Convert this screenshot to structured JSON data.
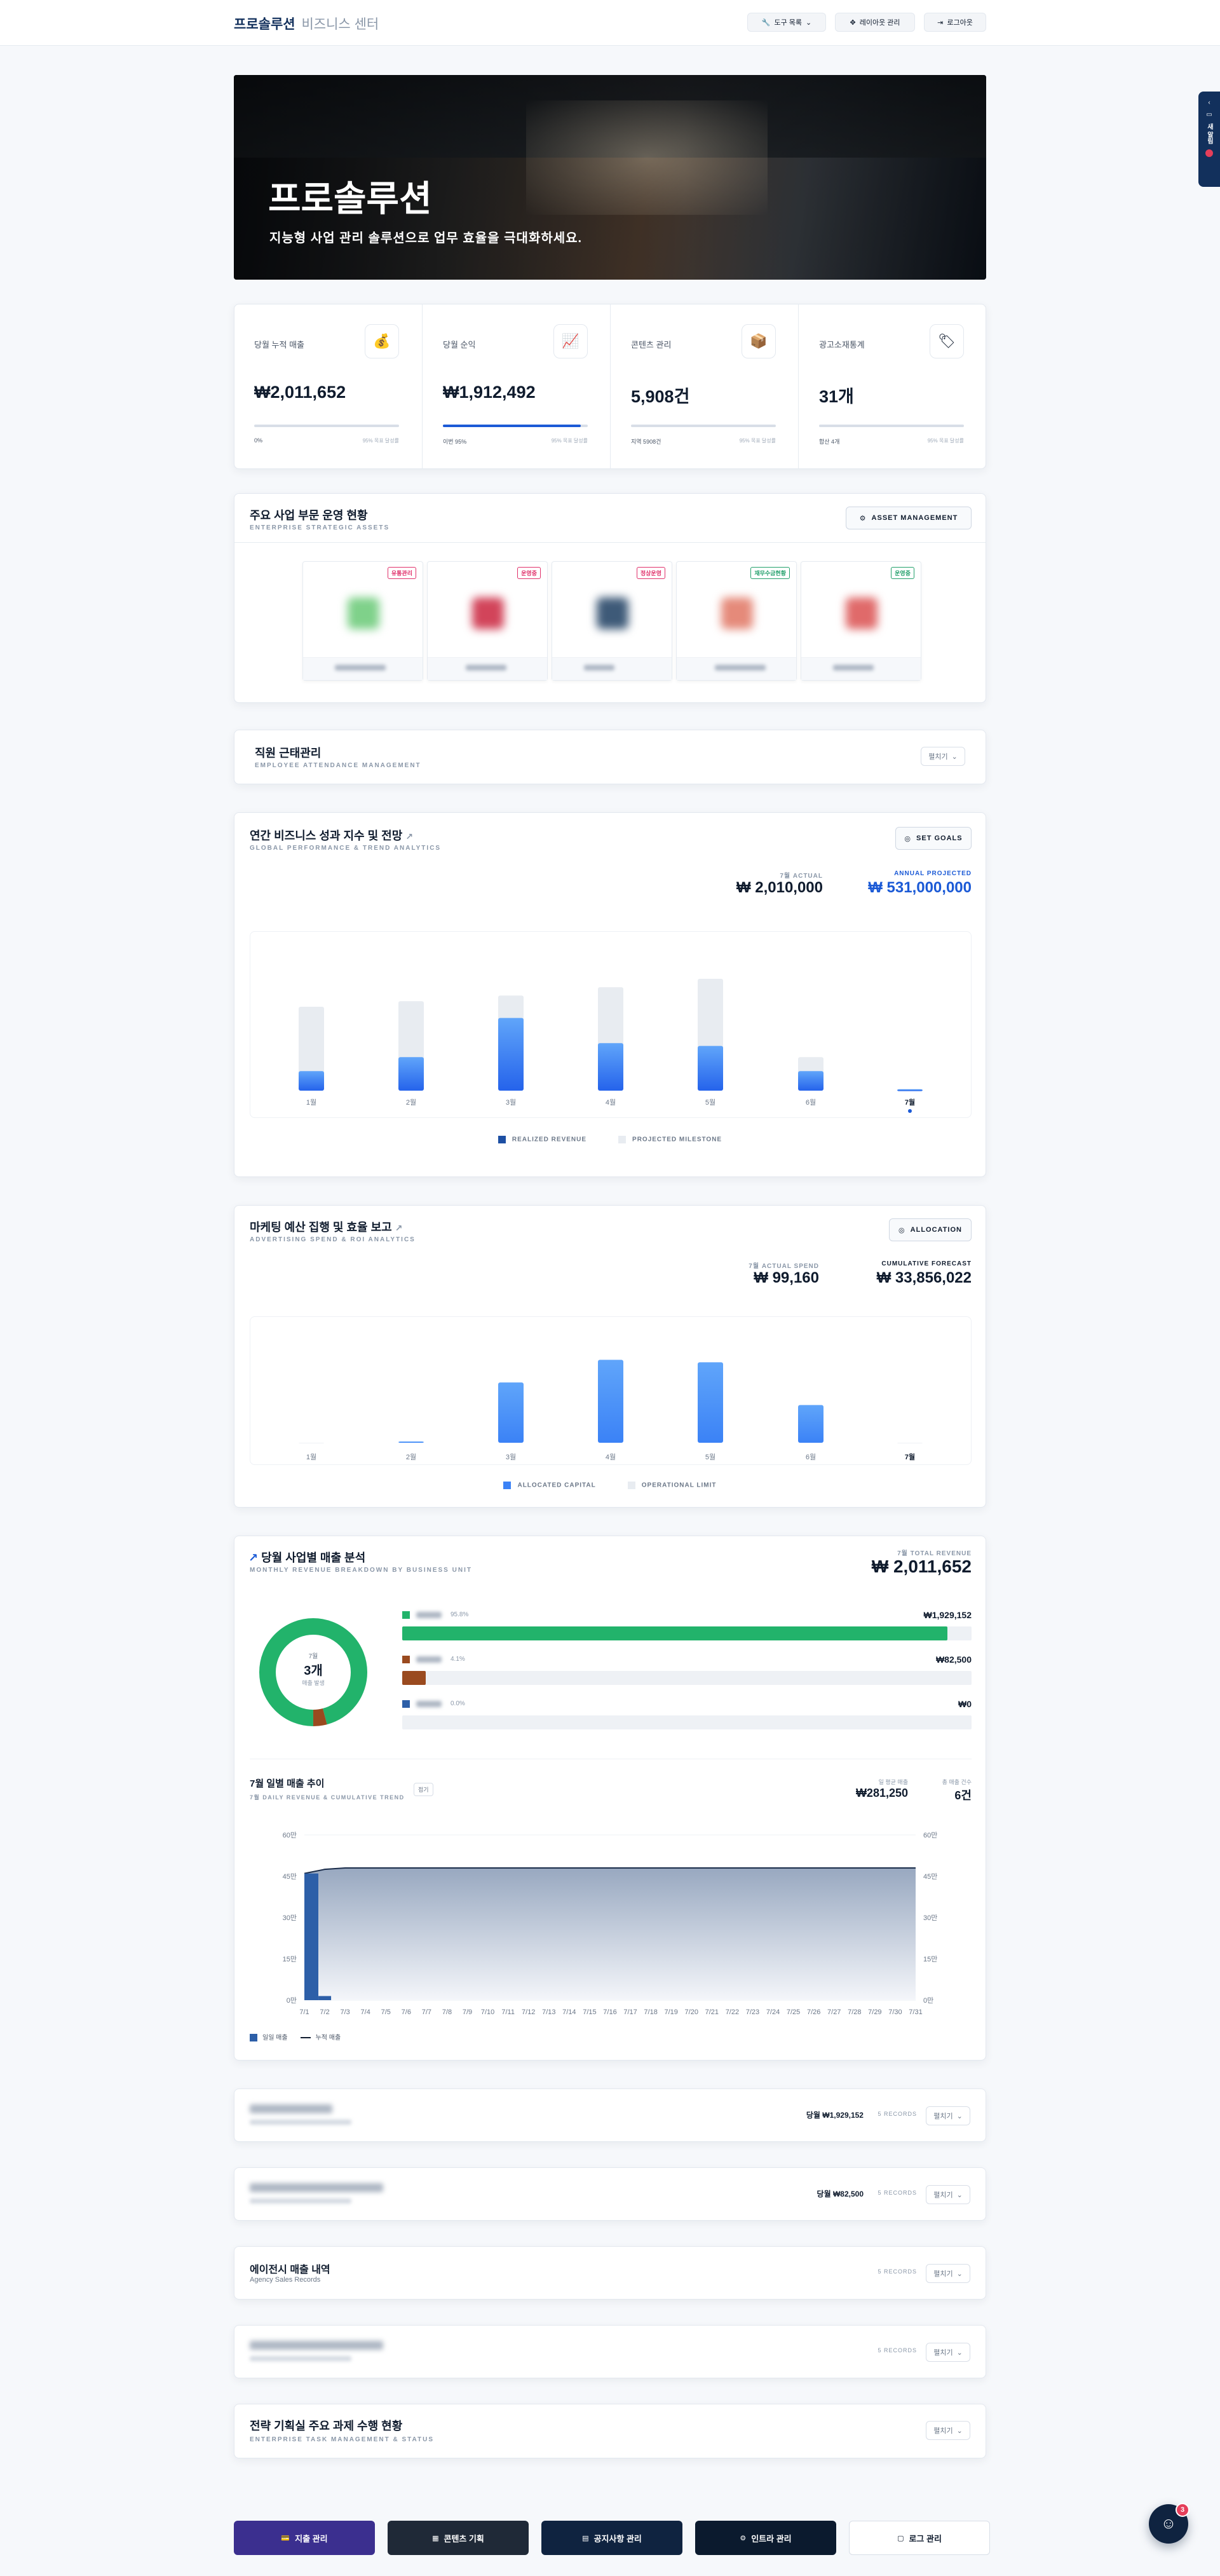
{
  "header": {
    "brand": "프로솔루션",
    "brand_sub": "비즈니스 센터",
    "tools_btn": "도구 목록",
    "layout_btn": "레이아웃 관리",
    "logout_btn": "로그아웃"
  },
  "side_tab": {
    "label": "새 알림"
  },
  "hero": {
    "title": "프로솔루션",
    "subtitle": "지능형 사업 관리 솔루션으로 업무 효율을 극대화하세요."
  },
  "stats": [
    {
      "label": "당월 누적 매출",
      "value": "₩2,011,652",
      "foot_left": "0%",
      "foot_right": "95% 목표 달성률",
      "progress": 0.0
    },
    {
      "label": "당월 순익",
      "value": "₩1,912,492",
      "foot_left": "이번 95%",
      "foot_right": "95% 목표 달성률",
      "progress": 0.95
    },
    {
      "label": "콘텐츠 관리",
      "value": "5,908건",
      "foot_left": "지역 5908건",
      "foot_right": "95% 목표 달성률",
      "progress": 0.0
    },
    {
      "label": "광고소재통계",
      "value": "31개",
      "foot_left": "합산 4개",
      "foot_right": "95% 목표 달성률",
      "progress": 0.0
    }
  ],
  "business": {
    "title": "주요 사업 부문 운영 현황",
    "subtitle": "ENTERPRISE STRATEGIC ASSETS",
    "button": "ASSET MANAGEMENT",
    "units": [
      {
        "badge": "유통관리",
        "badge_color": "#e0306a",
        "thumb": "#7fd18a"
      },
      {
        "badge": "운영중",
        "badge_color": "#e0306a",
        "thumb": "#d2445a"
      },
      {
        "badge": "정상운영",
        "badge_color": "#e0306a",
        "thumb": "#3e5a78"
      },
      {
        "badge": "재무수금현황",
        "badge_color": "#22a06b",
        "thumb": "#e58a7a"
      },
      {
        "badge": "운영중",
        "badge_color": "#22a06b",
        "thumb": "#e06a6a"
      }
    ]
  },
  "attendance": {
    "title": "직원 근태관리",
    "subtitle": "EMPLOYEE ATTENDANCE MANAGEMENT",
    "toggle": "펼치기"
  },
  "annual": {
    "title": "연간 비즈니스 성과 지수 및 전망",
    "subtitle": "GLOBAL PERFORMANCE & TREND ANALYTICS",
    "button": "SET GOALS",
    "actual_label": "7월 ACTUAL",
    "actual_value": "₩ 2,010,000",
    "projected_label": "ANNUAL PROJECTED",
    "projected_value": "₩ 531,000,000",
    "legend_realized": "REALIZED REVENUE",
    "legend_projected": "PROJECTED MILESTONE"
  },
  "marketing": {
    "title": "마케팅 예산 집행 및 효율 보고",
    "subtitle": "ADVERTISING SPEND & ROI ANALYTICS",
    "button": "ALLOCATION",
    "actual_label": "7월 ACTUAL SPEND",
    "actual_value": "₩ 99,160",
    "forecast_label": "CUMULATIVE FORECAST",
    "forecast_value": "₩ 33,856,022",
    "legend_allocated": "ALLOCATED CAPITAL",
    "legend_limit": "OPERATIONAL LIMIT"
  },
  "monthly": {
    "title": "당월 사업별 매출 분석",
    "subtitle": "MONTHLY REVENUE BREAKDOWN BY BUSINESS UNIT",
    "total_label": "7월 TOTAL REVENUE",
    "total_value": "₩ 2,011,652",
    "donut_month": "7월",
    "donut_count": "3개",
    "donut_caption": "매출 발생",
    "rows": [
      {
        "pct": "95.8%",
        "value": "₩1,929,152",
        "color": "#22b36b",
        "share": 0.958
      },
      {
        "pct": "4.1%",
        "value": "₩82,500",
        "color": "#9a4a1f",
        "share": 0.041
      },
      {
        "pct": "0.0%",
        "value": "₩0",
        "color": "#2d5fa8",
        "share": 0.0
      }
    ]
  },
  "daily": {
    "title": "7월 일별 매출 추이",
    "subtitle": "7월 DAILY REVENUE & CUMULATIVE TREND",
    "tag": "접기",
    "avg_label": "일 평균 매출",
    "avg_value": "₩281,250",
    "count_label": "총 매출 건수",
    "count_value": "6건",
    "legend_daily": "일일 매출",
    "legend_cum": "누적 매출"
  },
  "sections": [
    {
      "title": "",
      "subtitle": "",
      "amount": "당월 ₩1,929,152",
      "records": "5 RECORDS",
      "toggle": "펼치기",
      "blurred": true
    },
    {
      "title": "",
      "subtitle": "",
      "amount": "당월 ₩82,500",
      "records": "5 RECORDS",
      "toggle": "펼치기",
      "blurred": true
    },
    {
      "title": "에이전시 매출 내역",
      "subtitle": "Agency Sales Records",
      "amount": "",
      "records": "5 RECORDS",
      "toggle": "펼치기",
      "blurred": false
    },
    {
      "title": "",
      "subtitle": "",
      "amount": "",
      "records": "5 RECORDS",
      "toggle": "펼치기",
      "blurred": true
    }
  ],
  "tasks": {
    "title": "전략 기획실 주요 과제 수행 현황",
    "subtitle": "ENTERPRISE TASK MANAGEMENT & STATUS",
    "toggle": "펼치기"
  },
  "bottom_nav": [
    {
      "label": "지출 관리",
      "bg": "#3b2f8f",
      "fg": "#ffffff"
    },
    {
      "label": "콘텐츠 기획",
      "bg": "#1f2937",
      "fg": "#ffffff"
    },
    {
      "label": "공지사항 관리",
      "bg": "#0f2340",
      "fg": "#ffffff"
    },
    {
      "label": "인트라 관리",
      "bg": "#0b1a2e",
      "fg": "#ffffff"
    },
    {
      "label": "로그 관리",
      "bg": "#ffffff",
      "fg": "#0f1b2d"
    }
  ],
  "chat": {
    "badge": "3"
  },
  "chart_data": [
    {
      "type": "bar",
      "title": "연간 비즈니스 성과 지수 및 전망",
      "categories": [
        "1월",
        "2월",
        "3월",
        "4월",
        "5월",
        "6월",
        "7월"
      ],
      "series": [
        {
          "name": "REALIZED REVENUE",
          "values": [
            14,
            24,
            52,
            34,
            32,
            14,
            1
          ]
        },
        {
          "name": "PROJECTED MILESTONE",
          "values": [
            60,
            64,
            68,
            74,
            80,
            24,
            0
          ]
        }
      ],
      "ylim": [
        0,
        100
      ]
    },
    {
      "type": "bar",
      "title": "마케팅 예산 집행 및 효율 보고",
      "categories": [
        "1월",
        "2월",
        "3월",
        "4월",
        "5월",
        "6월",
        "7월"
      ],
      "series": [
        {
          "name": "ALLOCATED CAPITAL",
          "values": [
            0,
            1,
            48,
            66,
            64,
            30,
            0
          ]
        }
      ],
      "ylim": [
        0,
        90
      ]
    },
    {
      "type": "pie",
      "title": "당월 사업별 매출 분석",
      "values": [
        95.8,
        4.1,
        0.0
      ]
    },
    {
      "type": "bar",
      "title": "7월 일별 매출 추이",
      "categories": [
        "7/1",
        "7/2",
        "7/3",
        "7/4",
        "7/5",
        "7/6",
        "7/7",
        "7/8",
        "7/9",
        "7/10",
        "7/11",
        "7/12",
        "7/13",
        "7/14",
        "7/15",
        "7/16",
        "7/17",
        "7/18",
        "7/19",
        "7/20",
        "7/21",
        "7/22",
        "7/23",
        "7/24",
        "7/25",
        "7/26",
        "7/27",
        "7/28",
        "7/29",
        "7/30",
        "7/31"
      ],
      "series": [
        {
          "name": "일일 매출",
          "values": [
            46,
            1.5,
            0,
            0,
            0,
            0,
            0,
            0,
            0,
            0,
            0,
            0,
            0,
            0,
            0,
            0,
            0,
            0,
            0,
            0,
            0,
            0,
            0,
            0,
            0,
            0,
            0,
            0,
            0,
            0,
            0
          ]
        },
        {
          "name": "누적 매출",
          "values": [
            46,
            47.5,
            48,
            48,
            48,
            48,
            48,
            48,
            48,
            48,
            48,
            48,
            48,
            48,
            48,
            48,
            48,
            48,
            48,
            48,
            48,
            48,
            48,
            48,
            48,
            48,
            48,
            48,
            48,
            48,
            48
          ]
        }
      ],
      "yticks_left": [
        "0만",
        "15만",
        "30만",
        "45만",
        "60만"
      ],
      "yticks_right": [
        "0만",
        "15만",
        "30만",
        "45만",
        "60만"
      ],
      "ylim": [
        0,
        60
      ]
    }
  ]
}
